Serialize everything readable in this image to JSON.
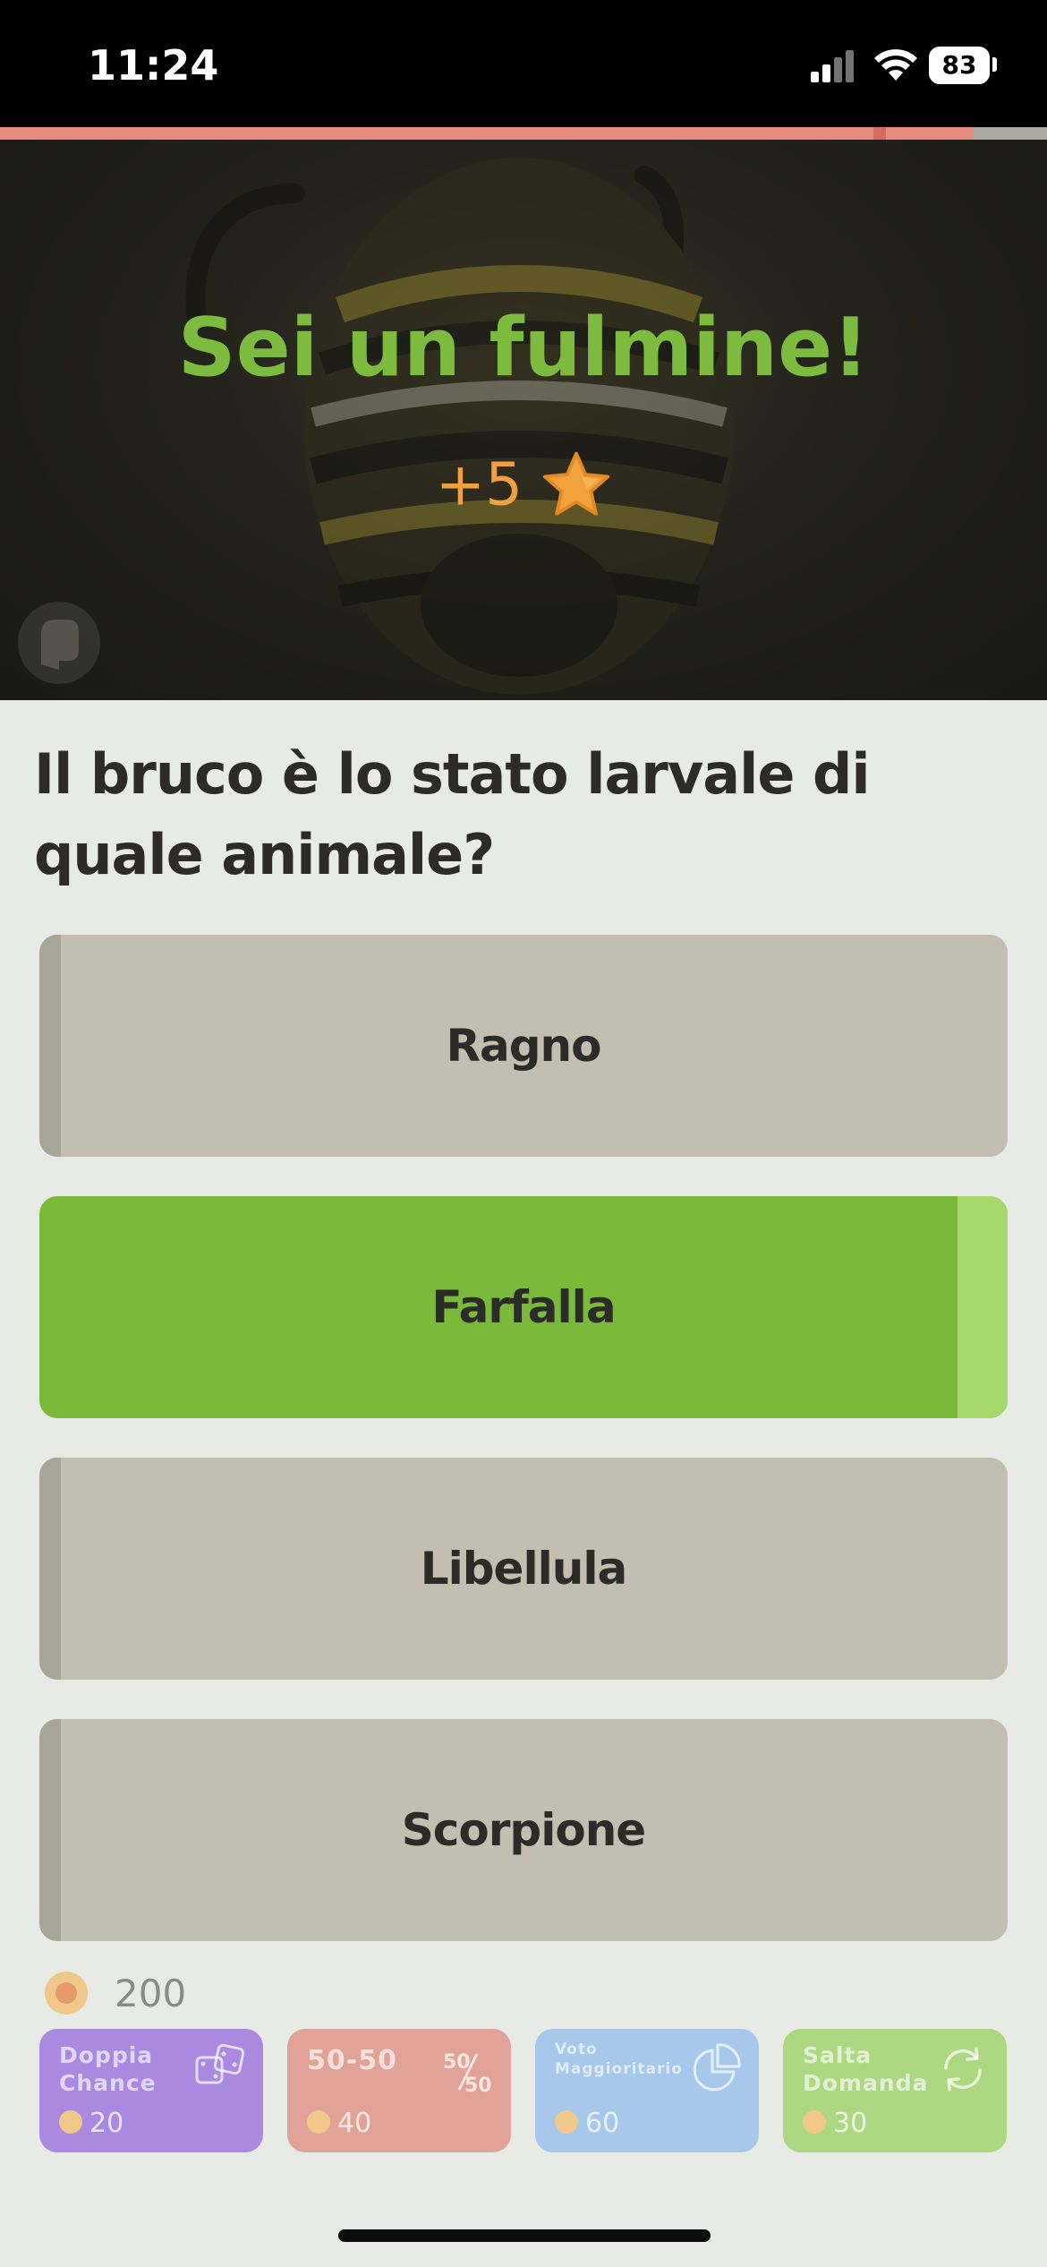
{
  "status_bar": {
    "time": "11:24",
    "battery": "83"
  },
  "progress": {
    "fraction": 0.93
  },
  "feedback": {
    "title": "Sei un fulmine!",
    "reward": "+5"
  },
  "question": {
    "text": "Il bruco è lo stato larvale di quale animale?"
  },
  "answers": [
    {
      "label": "Ragno",
      "state": "neutral"
    },
    {
      "label": "Farfalla",
      "state": "correct"
    },
    {
      "label": "Libellula",
      "state": "neutral"
    },
    {
      "label": "Scorpione",
      "state": "neutral"
    }
  ],
  "coins": {
    "balance": "200"
  },
  "powerups": [
    {
      "name_line1": "Doppia",
      "name_line2": "Chance",
      "cost": "20",
      "icon": "dice-icon",
      "color": "#a98ae0"
    },
    {
      "name_line1": "50-50",
      "name_line2": "",
      "cost": "40",
      "icon": "fifty-fifty-icon",
      "color": "#e1a397"
    },
    {
      "name_line1": "Voto",
      "name_line2": "Maggioritario",
      "cost": "60",
      "icon": "pie-chart-icon",
      "color": "#a7c8ea"
    },
    {
      "name_line1": "Salta",
      "name_line2": "Domanda",
      "cost": "30",
      "icon": "refresh-icon",
      "color": "#add781"
    }
  ]
}
